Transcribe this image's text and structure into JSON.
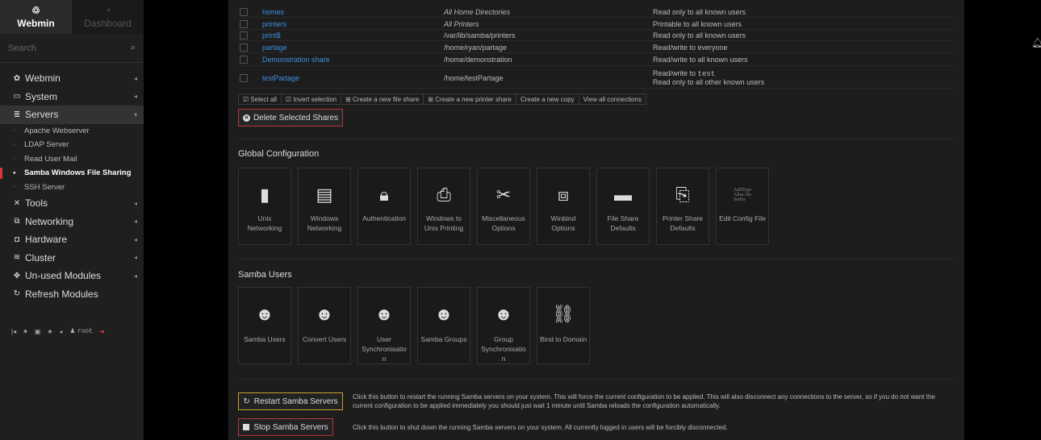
{
  "sidebar": {
    "tab_webmin": "Webmin",
    "tab_dashboard": "Dashboard",
    "search_placeholder": "Search",
    "menu": [
      {
        "label": "Webmin"
      },
      {
        "label": "System"
      },
      {
        "label": "Servers"
      }
    ],
    "servers_sub": [
      {
        "label": "Apache Webserver"
      },
      {
        "label": "LDAP Server"
      },
      {
        "label": "Read User Mail"
      },
      {
        "label": "Samba Windows File Sharing"
      },
      {
        "label": "SSH Server"
      }
    ],
    "menu2": [
      {
        "label": "Tools"
      },
      {
        "label": "Networking"
      },
      {
        "label": "Hardware"
      },
      {
        "label": "Cluster"
      },
      {
        "label": "Un-used Modules"
      },
      {
        "label": "Refresh Modules"
      }
    ],
    "user": "root"
  },
  "shares": [
    {
      "name": "homes",
      "path": "All Home Directories",
      "access": "Read only to all known users"
    },
    {
      "name": "printers",
      "path": "All Printers",
      "access": "Printable to all known users"
    },
    {
      "name": "print$",
      "path": "/var/lib/samba/printers",
      "access": "Read only to all known users"
    },
    {
      "name": "partage",
      "path": "/home/ryan/partage",
      "access": "Read/write to everyone"
    },
    {
      "name": "Demonstration share",
      "path": "/home/demonstration",
      "access": "Read/write to all known users"
    },
    {
      "name": "testPartage",
      "path": "/home/testPartage",
      "access_line1": "Read/write to",
      "access_user": "test",
      "access_line2": "Read only to all other known users"
    }
  ],
  "actions": {
    "select_all": "Select all",
    "invert": "Invert selection",
    "new_file": "Create a new file share",
    "new_printer": "Create a new printer share",
    "new_copy": "Create a new copy",
    "view_conn": "View all connections",
    "delete": "Delete Selected Shares"
  },
  "global": {
    "title": "Global Configuration",
    "tiles": [
      {
        "l1": "Unix",
        "l2": "Networking"
      },
      {
        "l1": "Windows",
        "l2": "Networking"
      },
      {
        "l1": "Authentication",
        "l2": ""
      },
      {
        "l1": "Windows to",
        "l2": "Unix Printing"
      },
      {
        "l1": "Miscellaneous",
        "l2": "Options"
      },
      {
        "l1": "Winbind",
        "l2": "Options"
      },
      {
        "l1": "File Share",
        "l2": "Defaults"
      },
      {
        "l1": "Printer Share",
        "l2": "Defaults"
      },
      {
        "l1": "Edit Config File",
        "l2": ""
      }
    ],
    "config_icon_text": [
      "AddType",
      "Alias /do",
      "SetHa"
    ]
  },
  "users": {
    "title": "Samba Users",
    "tiles": [
      {
        "l1": "Samba Users",
        "l2": "",
        "l3": ""
      },
      {
        "l1": "Convert Users",
        "l2": "",
        "l3": ""
      },
      {
        "l1": "User",
        "l2": "Synchronisatio",
        "l3": "n"
      },
      {
        "l1": "Samba Groups",
        "l2": "",
        "l3": ""
      },
      {
        "l1": "Group",
        "l2": "Synchronisatio",
        "l3": "n"
      },
      {
        "l1": "Bind to Domain",
        "l2": "",
        "l3": ""
      }
    ]
  },
  "server": {
    "restart_label": "Restart Samba Servers",
    "restart_desc": "Click this button to restart the running Samba servers on your system. This will force the current configuration to be applied. This will also disconnect any connections to the server, so if you do not want the current configuration to be applied immediately you should just wait 1 minute until Samba reloads the configuration automatically.",
    "stop_label": "Stop Samba Servers",
    "stop_desc": "Click this button to shut down the running Samba servers on your system. All currently logged in users will be forcibly disconnected."
  }
}
